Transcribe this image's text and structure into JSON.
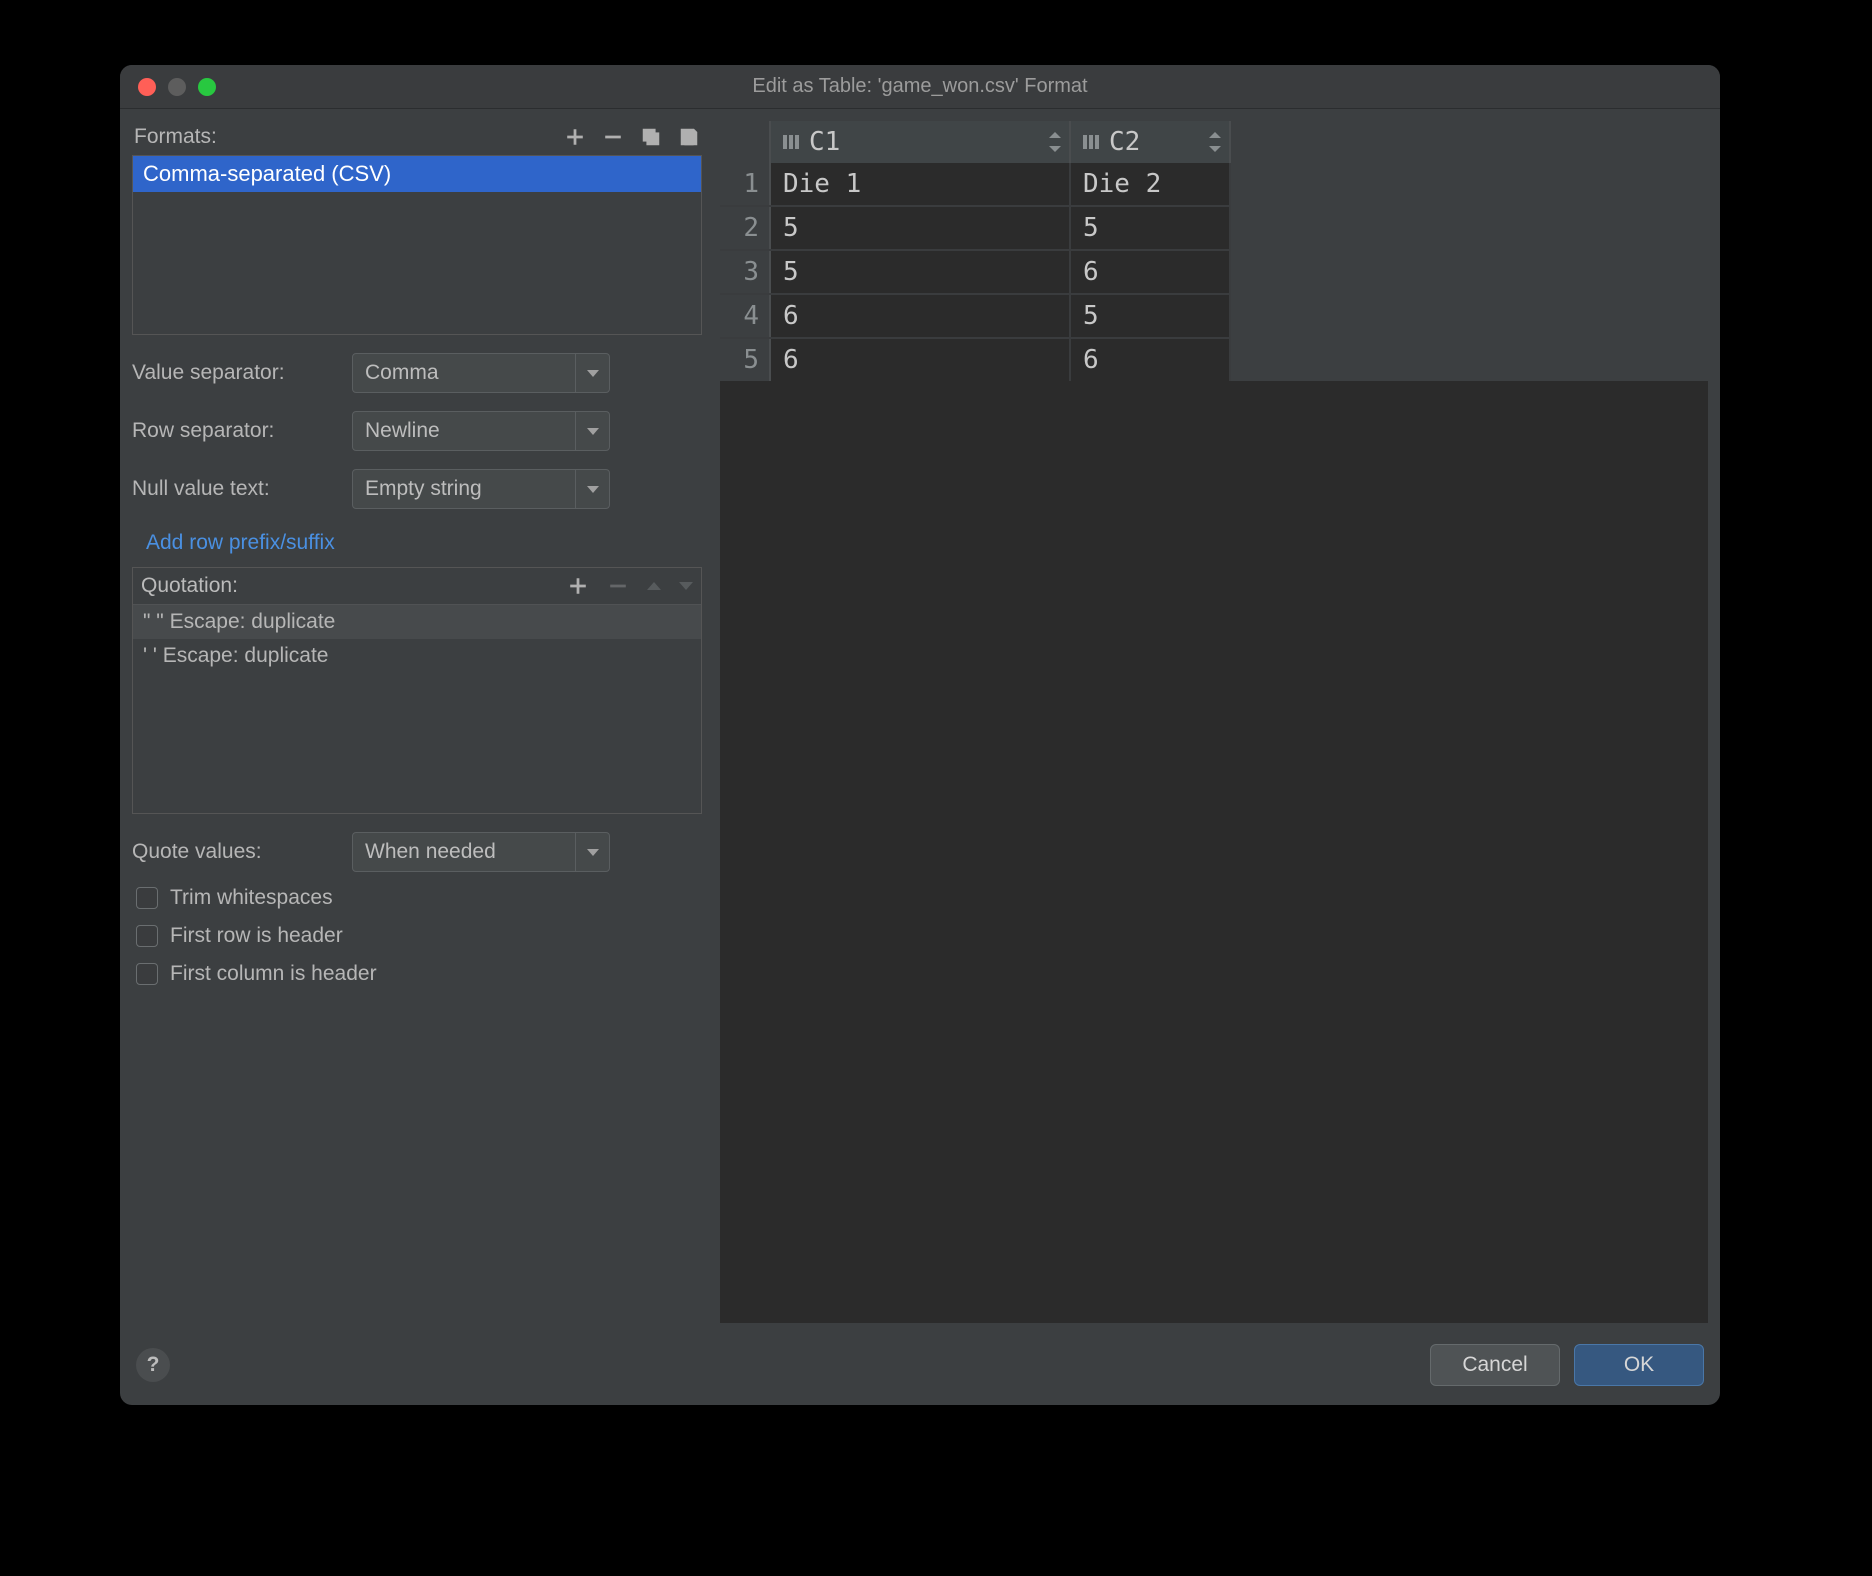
{
  "window": {
    "title": "Edit as Table: 'game_won.csv' Format"
  },
  "formats": {
    "label": "Formats:",
    "selected": "Comma-separated (CSV)"
  },
  "value_separator": {
    "label": "Value separator:",
    "value": "Comma"
  },
  "row_separator": {
    "label": "Row separator:",
    "value": "Newline"
  },
  "null_value_text": {
    "label": "Null value text:",
    "value": "Empty string"
  },
  "add_row_link": "Add row prefix/suffix",
  "quotation": {
    "label": "Quotation:",
    "rules": [
      "\"  \"   Escape: duplicate",
      "'  '   Escape: duplicate"
    ]
  },
  "quote_values": {
    "label": "Quote values:",
    "value": "When needed"
  },
  "checkboxes": {
    "trim_whitespaces": {
      "label": "Trim whitespaces",
      "checked": false
    },
    "first_row_header": {
      "label": "First row is header",
      "checked": false
    },
    "first_col_header": {
      "label": "First column is header",
      "checked": false
    }
  },
  "table": {
    "columns": [
      "C1",
      "C2"
    ],
    "rows": [
      {
        "n": "1",
        "c1": "Die 1",
        "c2": "Die 2"
      },
      {
        "n": "2",
        "c1": "5",
        "c2": "5"
      },
      {
        "n": "3",
        "c1": "5",
        "c2": "6"
      },
      {
        "n": "4",
        "c1": "6",
        "c2": "5"
      },
      {
        "n": "5",
        "c1": "6",
        "c2": "6"
      }
    ]
  },
  "footer": {
    "help": "?",
    "cancel": "Cancel",
    "ok": "OK"
  }
}
